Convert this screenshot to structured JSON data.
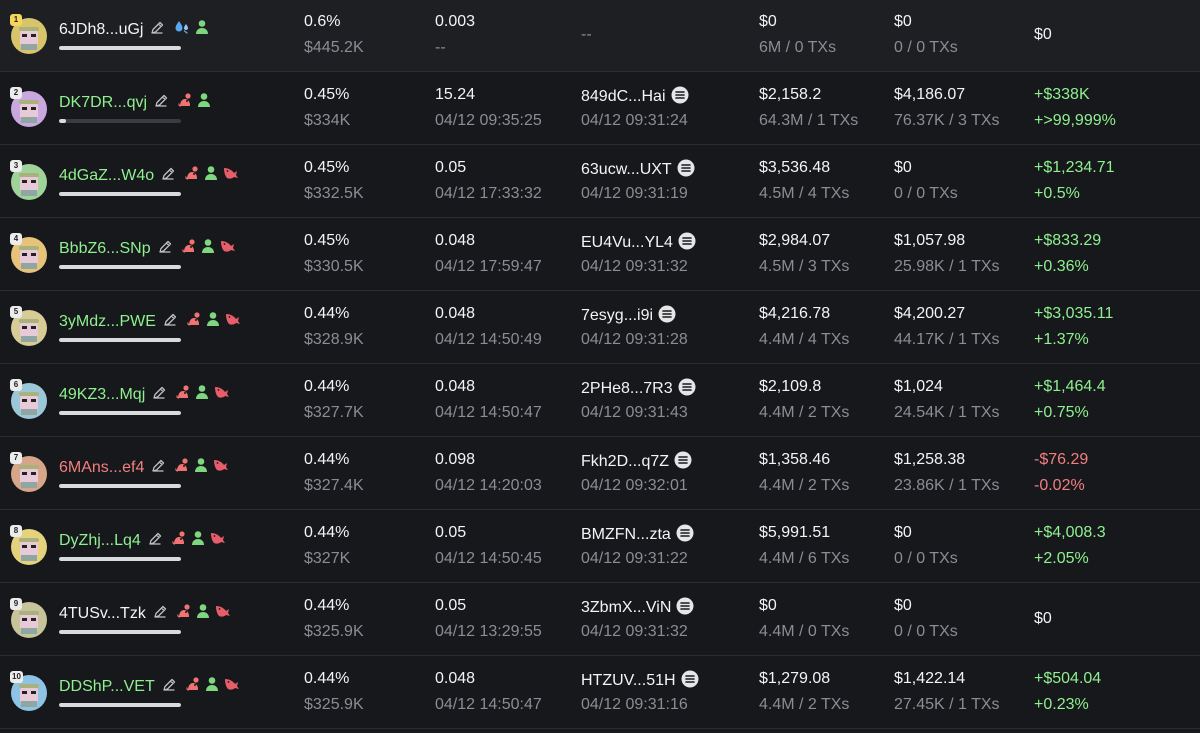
{
  "colors": {
    "background": "#17181b",
    "positive": "#8ff08f",
    "negative": "#f27f7f",
    "muted": "#8a8d94",
    "text": "#f4f4f5"
  },
  "icons": {
    "edit": "pencil-icon",
    "trader": "water-drop-icon",
    "developer": "mouse-icon",
    "user": "person-icon",
    "whale": "fish-icon",
    "source": "solana-icon"
  },
  "rows": [
    {
      "rank": "1",
      "address": "6JDh8...uGj",
      "address_color": "white",
      "badges": [
        "water-drop-icon",
        "person-icon"
      ],
      "holding_fill": 1.0,
      "percent": "0.6%",
      "value": "$445.2K",
      "balance": "0.003",
      "balance_time": "--",
      "source": "--",
      "source_time": "",
      "bought": "$0",
      "bought_detail": "6M / 0 TXs",
      "sold": "$0",
      "sold_detail": "0 / 0 TXs",
      "pnl": "$0",
      "pnl_pct": "",
      "pnl_sign": "zero"
    },
    {
      "rank": "2",
      "address": "DK7DR...qvj",
      "address_color": "green",
      "badges": [
        "mouse-icon",
        "person-icon"
      ],
      "holding_fill": 0.06,
      "percent": "0.45%",
      "value": "$334K",
      "balance": "15.24",
      "balance_time": "04/12 09:35:25",
      "source": "849dC...Hai",
      "source_time": "04/12 09:31:24",
      "bought": "$2,158.2",
      "bought_detail": "64.3M / 1 TXs",
      "sold": "$4,186.07",
      "sold_detail": "76.37K / 3 TXs",
      "pnl": "+$338K",
      "pnl_pct": "+>99,999%",
      "pnl_sign": "pos"
    },
    {
      "rank": "3",
      "address": "4dGaZ...W4o",
      "address_color": "green",
      "badges": [
        "mouse-icon",
        "person-icon",
        "fish-icon"
      ],
      "holding_fill": 1.0,
      "percent": "0.45%",
      "value": "$332.5K",
      "balance": "0.05",
      "balance_time": "04/12 17:33:32",
      "source": "63ucw...UXT",
      "source_time": "04/12 09:31:19",
      "bought": "$3,536.48",
      "bought_detail": "4.5M / 4 TXs",
      "sold": "$0",
      "sold_detail": "0 / 0 TXs",
      "pnl": "+$1,234.71",
      "pnl_pct": "+0.5%",
      "pnl_sign": "pos"
    },
    {
      "rank": "4",
      "address": "BbbZ6...SNp",
      "address_color": "green",
      "badges": [
        "mouse-icon",
        "person-icon",
        "fish-icon"
      ],
      "holding_fill": 1.0,
      "percent": "0.45%",
      "value": "$330.5K",
      "balance": "0.048",
      "balance_time": "04/12 17:59:47",
      "source": "EU4Vu...YL4",
      "source_time": "04/12 09:31:32",
      "bought": "$2,984.07",
      "bought_detail": "4.5M / 3 TXs",
      "sold": "$1,057.98",
      "sold_detail": "25.98K / 1 TXs",
      "pnl": "+$833.29",
      "pnl_pct": "+0.36%",
      "pnl_sign": "pos"
    },
    {
      "rank": "5",
      "address": "3yMdz...PWE",
      "address_color": "green",
      "badges": [
        "mouse-icon",
        "person-icon",
        "fish-icon"
      ],
      "holding_fill": 1.0,
      "percent": "0.44%",
      "value": "$328.9K",
      "balance": "0.048",
      "balance_time": "04/12 14:50:49",
      "source": "7esyg...i9i",
      "source_time": "04/12 09:31:28",
      "bought": "$4,216.78",
      "bought_detail": "4.4M / 4 TXs",
      "sold": "$4,200.27",
      "sold_detail": "44.17K / 1 TXs",
      "pnl": "+$3,035.11",
      "pnl_pct": "+1.37%",
      "pnl_sign": "pos"
    },
    {
      "rank": "6",
      "address": "49KZ3...Mqj",
      "address_color": "green",
      "badges": [
        "mouse-icon",
        "person-icon",
        "fish-icon"
      ],
      "holding_fill": 1.0,
      "percent": "0.44%",
      "value": "$327.7K",
      "balance": "0.048",
      "balance_time": "04/12 14:50:47",
      "source": "2PHe8...7R3",
      "source_time": "04/12 09:31:43",
      "bought": "$2,109.8",
      "bought_detail": "4.4M / 2 TXs",
      "sold": "$1,024",
      "sold_detail": "24.54K / 1 TXs",
      "pnl": "+$1,464.4",
      "pnl_pct": "+0.75%",
      "pnl_sign": "pos"
    },
    {
      "rank": "7",
      "address": "6MAns...ef4",
      "address_color": "red",
      "badges": [
        "mouse-icon",
        "person-icon",
        "fish-icon"
      ],
      "holding_fill": 1.0,
      "percent": "0.44%",
      "value": "$327.4K",
      "balance": "0.098",
      "balance_time": "04/12 14:20:03",
      "source": "Fkh2D...q7Z",
      "source_time": "04/12 09:32:01",
      "bought": "$1,358.46",
      "bought_detail": "4.4M / 2 TXs",
      "sold": "$1,258.38",
      "sold_detail": "23.86K / 1 TXs",
      "pnl": "-$76.29",
      "pnl_pct": "-0.02%",
      "pnl_sign": "neg"
    },
    {
      "rank": "8",
      "address": "DyZhj...Lq4",
      "address_color": "green",
      "badges": [
        "mouse-icon",
        "person-icon",
        "fish-icon"
      ],
      "holding_fill": 1.0,
      "percent": "0.44%",
      "value": "$327K",
      "balance": "0.05",
      "balance_time": "04/12 14:50:45",
      "source": "BMZFN...zta",
      "source_time": "04/12 09:31:22",
      "bought": "$5,991.51",
      "bought_detail": "4.4M / 6 TXs",
      "sold": "$0",
      "sold_detail": "0 / 0 TXs",
      "pnl": "+$4,008.3",
      "pnl_pct": "+2.05%",
      "pnl_sign": "pos"
    },
    {
      "rank": "9",
      "address": "4TUSv...Tzk",
      "address_color": "white",
      "badges": [
        "mouse-icon",
        "person-icon",
        "fish-icon"
      ],
      "holding_fill": 1.0,
      "percent": "0.44%",
      "value": "$325.9K",
      "balance": "0.05",
      "balance_time": "04/12 13:29:55",
      "source": "3ZbmX...ViN",
      "source_time": "04/12 09:31:32",
      "bought": "$0",
      "bought_detail": "4.4M / 0 TXs",
      "sold": "$0",
      "sold_detail": "0 / 0 TXs",
      "pnl": "$0",
      "pnl_pct": "",
      "pnl_sign": "zero"
    },
    {
      "rank": "10",
      "address": "DDShP...VET",
      "address_color": "green",
      "badges": [
        "mouse-icon",
        "person-icon",
        "fish-icon"
      ],
      "holding_fill": 1.0,
      "percent": "0.44%",
      "value": "$325.9K",
      "balance": "0.048",
      "balance_time": "04/12 14:50:47",
      "source": "HTZUV...51H",
      "source_time": "04/12 09:31:16",
      "bought": "$1,279.08",
      "bought_detail": "4.4M / 2 TXs",
      "sold": "$1,422.14",
      "sold_detail": "27.45K / 1 TXs",
      "pnl": "+$504.04",
      "pnl_pct": "+0.23%",
      "pnl_sign": "pos"
    }
  ]
}
